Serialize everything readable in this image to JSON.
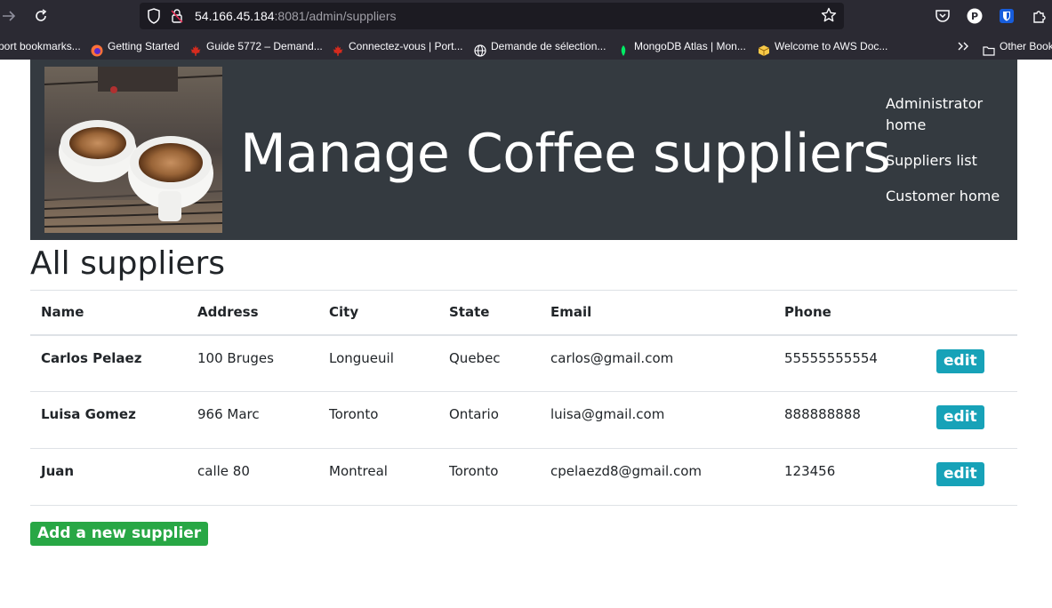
{
  "browser": {
    "url_host": "54.166.45.184",
    "url_rest": ":8081/admin/suppliers",
    "bookmarks": [
      {
        "label": "port bookmarks...",
        "icon": "none"
      },
      {
        "label": "Getting Started",
        "icon": "firefox-icon"
      },
      {
        "label": "Guide 5772 – Demand...",
        "icon": "maple-leaf-icon"
      },
      {
        "label": "Connectez-vous | Port...",
        "icon": "maple-leaf-icon"
      },
      {
        "label": "Demande de sélection...",
        "icon": "globe-icon"
      },
      {
        "label": "MongoDB Atlas | Mon...",
        "icon": "mongodb-leaf-icon"
      },
      {
        "label": "Welcome to AWS Doc...",
        "icon": "aws-box-icon"
      }
    ],
    "other_bookmarks": "Other Bookm"
  },
  "banner": {
    "title": "Manage Coffee suppliers",
    "nav": [
      {
        "label": "Administrator home"
      },
      {
        "label": "Suppliers list"
      },
      {
        "label": "Customer home"
      }
    ]
  },
  "section_title": "All suppliers",
  "table": {
    "headers": {
      "name": "Name",
      "address": "Address",
      "city": "City",
      "state": "State",
      "email": "Email",
      "phone": "Phone"
    },
    "rows": [
      {
        "name": "Carlos Pelaez",
        "address": "100 Bruges",
        "city": "Longueuil",
        "state": "Quebec",
        "email": "carlos@gmail.com",
        "phone": "55555555554",
        "action": "edit"
      },
      {
        "name": "Luisa Gomez",
        "address": "966 Marc",
        "city": "Toronto",
        "state": "Ontario",
        "email": "luisa@gmail.com",
        "phone": "888888888",
        "action": "edit"
      },
      {
        "name": "Juan",
        "address": "calle 80",
        "city": "Montreal",
        "state": "Toronto",
        "email": "cpelaezd8@gmail.com",
        "phone": "123456",
        "action": "edit"
      }
    ]
  },
  "add_button": "Add a new supplier",
  "colors": {
    "banner_bg": "#343a40",
    "edit_button": "#17a2b8",
    "add_button": "#28a745",
    "browser_chrome": "#2b2a33"
  }
}
